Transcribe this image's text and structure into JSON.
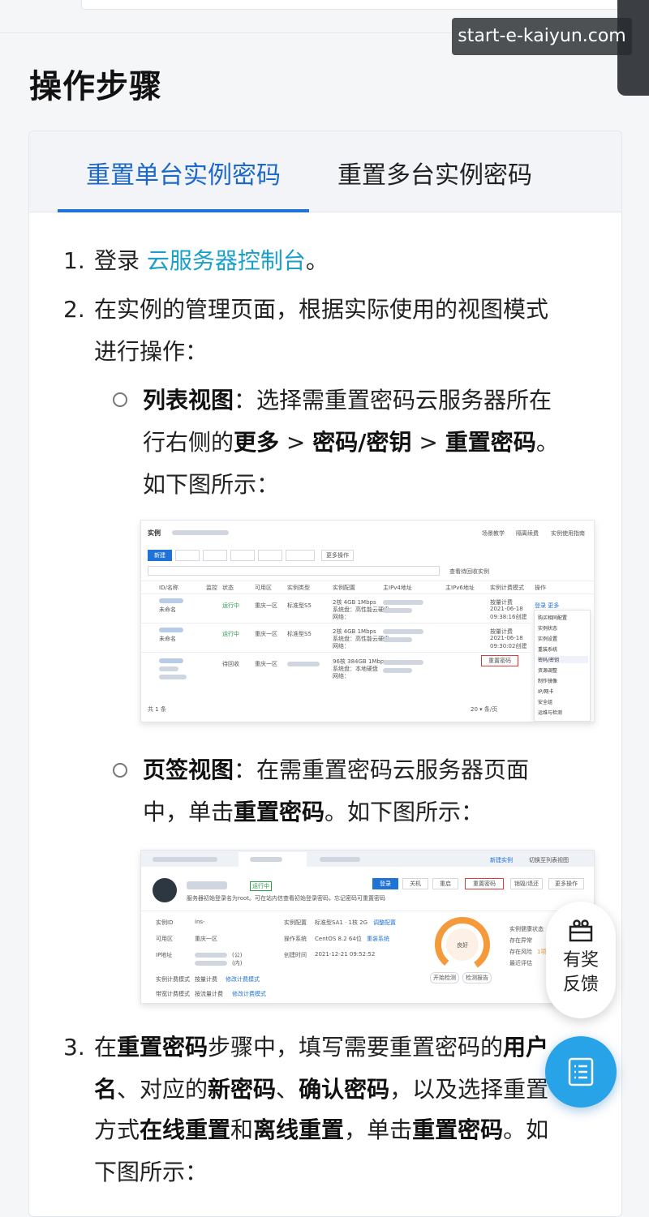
{
  "watermark": "start-e-kaiyun.com",
  "page": {
    "title": "操作步骤"
  },
  "tabs": [
    {
      "label": "重置单台实例密码",
      "active": true
    },
    {
      "label": "重置多台实例密码",
      "active": false
    }
  ],
  "steps": {
    "s1": {
      "num": "1.",
      "pre": "登录 ",
      "link": "云服务器控制台",
      "post": "。"
    },
    "s2": {
      "num": "2.",
      "line1": "在实例的管理页面，根据实际使用的视图模式",
      "line2": "进行操作："
    },
    "list_view": {
      "title": "列表视图",
      "l1": "：选择需重置密码云服务器所在",
      "l2_pre": "行右侧的",
      "more": "更多",
      "sep1": " > ",
      "pwdkey": "密码/密钥",
      "sep2": " > ",
      "reset": "重置密码",
      "l2_post": "。",
      "l3": "如下图所示："
    },
    "tab_view": {
      "title": "页签视图",
      "l1": "：在需重置密码云服务器页面",
      "l2_pre": "中，单击",
      "reset": "重置密码",
      "l2_post": "。如下图所示："
    },
    "s3": {
      "num": "3.",
      "l1_a": "在",
      "l1_b": "重置密码",
      "l1_c": "步骤中，填写需要重置密码的",
      "l1_d": "用户",
      "l2_a": "名",
      "l2_b": "、对应的",
      "l2_c": "新密码",
      "l2_d": "、",
      "l2_e": "确认密码",
      "l2_f": "，以及选择重置",
      "l3_a": "方式",
      "l3_b": "在线重置",
      "l3_c": "和",
      "l3_d": "离线重置",
      "l3_e": "，单击",
      "l3_f": "重置密码",
      "l3_g": "。如",
      "l4": "下图所示："
    }
  },
  "shot1": {
    "title": "实例",
    "top_links": [
      "场景教学",
      "隔离续费",
      "实例使用指南"
    ],
    "new_btn": "新建",
    "more_ops": "更多操作",
    "recycle": "查看待回收实例",
    "headers": [
      "ID/名称",
      "监控",
      "状态",
      "可用区",
      "实例类型",
      "实例配置",
      "主IPv4地址",
      "主IPv6地址",
      "实例计费模式",
      "操作"
    ],
    "rows": [
      {
        "name": "未命名",
        "status": "运行中",
        "zone": "重庆一区",
        "type": "标准型S5",
        "cfg1": "2核 4GB 1Mbps",
        "cfg2": "系统盘：高性能云硬盘",
        "cfg3": "网络：",
        "billing": "按量计费",
        "date": "2021-06-18",
        "time": "09:38:16创建",
        "ops": "登录  更多"
      },
      {
        "name": "未命名",
        "status": "运行中",
        "zone": "重庆一区",
        "type": "标准型S5",
        "cfg1": "2核 4GB 1Mbps",
        "cfg2": "系统盘：高性能云硬盘",
        "cfg3": "网络：",
        "billing": "按量计费",
        "date": "2021-06-18",
        "time": "09:30:02创建"
      },
      {
        "name": "",
        "status": "待回收",
        "zone": "重庆一区",
        "type": "",
        "cfg1": "96核 384GB 1Mbps",
        "cfg2": "系统盘：本地硬盘",
        "cfg3": "网络：",
        "billing": "重置密码",
        "date": "",
        "time": ""
      }
    ],
    "menu": [
      "购买相同配置",
      "实例状态",
      "实例设置",
      "重装系统",
      "密码/密钥",
      "资源调整",
      "制作镜像",
      "IP/网卡",
      "安全组",
      "运维与检测"
    ],
    "footer_left": "共 1 条",
    "footer_right": "20 ▾ 条/页"
  },
  "shot2": {
    "new_instance": "新建实例",
    "switch_list": "切换至列表视图",
    "status": "运行中",
    "hint": "服务器初始登录名为root。可在站内信查看初始登录密码，忘记密码可重置密码",
    "buttons": [
      "登录",
      "关机",
      "重启",
      "重置密码",
      "销毁/退还",
      "更多操作"
    ],
    "fields": [
      {
        "label": "实例ID",
        "value": "ins-"
      },
      {
        "label": "可用区",
        "value": "重庆一区"
      },
      {
        "label": "IP地址",
        "value": "(公)"
      },
      {
        "label": "",
        "value": "(内)"
      },
      {
        "label": "实例计费模式",
        "value": "按量计费"
      },
      {
        "label": "带宽计费模式",
        "value": "按流量计费"
      }
    ],
    "fields2": [
      {
        "label": "实例配置",
        "value": "标准型SA1 · 1核 2G"
      },
      {
        "label": "操作系统",
        "value": "CentOS 8.2 64位"
      },
      {
        "label": "创建时间",
        "value": "2021-12-21 09:52:52"
      }
    ],
    "change_cfg": "调整配置",
    "reinstall": "重装系统",
    "change_billing": "修改计费模式",
    "change_bw": "修改计费模式",
    "gauge_label": "良好",
    "check_btn": "开始检测",
    "report_btn": "检测报告",
    "health": "实例健康状态",
    "health_rows": [
      "存在异常",
      "存在风险",
      "最近评估"
    ],
    "health_val": "1项"
  },
  "float": {
    "reward_l1": "有奖",
    "reward_l2": "反馈"
  },
  "colors": {
    "accent": "#1f73d7",
    "link": "#1aa0c8",
    "float_blue": "#29a3e8"
  }
}
